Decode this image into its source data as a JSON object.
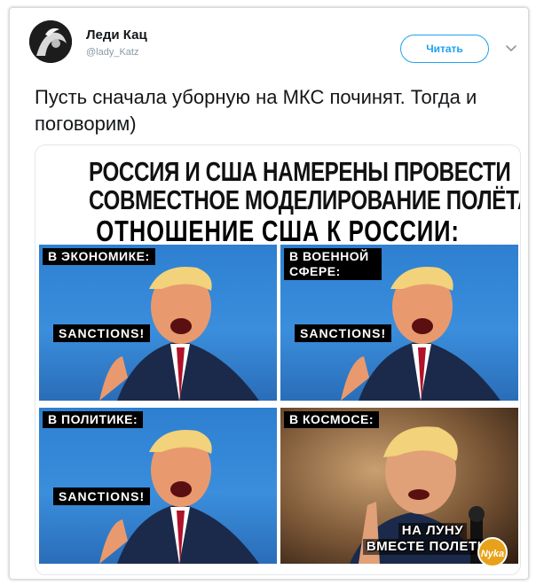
{
  "tweet": {
    "display_name": "Леди Кац",
    "handle": "@lady_Katz",
    "follow_label": "Читать",
    "text": "Пусть сначала уборную на МКС починят. Тогда и поговорим)"
  },
  "meme": {
    "headline_1": "РОССИЯ И США НАМЕРЕНЫ ПРОВЕСТИ",
    "headline_2": "СОВМЕСТНОЕ МОДЕЛИРОВАНИЕ ПОЛЁТА НА ЛУНУ",
    "headline_3": "ОТНОШЕНИЕ США К РОССИИ:",
    "panels": [
      {
        "label": "В ЭКОНОМИКЕ:",
        "speech": "SANCTIONS!"
      },
      {
        "label": "В ВОЕННОЙ СФЕРЕ:",
        "speech": "SANCTIONS!"
      },
      {
        "label": "В ПОЛИТИКЕ:",
        "speech": "SANCTIONS!"
      },
      {
        "label": "В КОСМОСЕ:",
        "speech_line_1": "НА ЛУНУ",
        "speech_line_2": "ВМЕСТЕ ПОЛЕТИМ"
      }
    ],
    "watermark": "Nyka"
  },
  "colors": {
    "accent": "#1da1f2",
    "panel_blue": "#3a8edc",
    "text": "#14171a",
    "muted": "#8899a6"
  },
  "icons": [
    "avatar",
    "chevron-down-icon"
  ]
}
